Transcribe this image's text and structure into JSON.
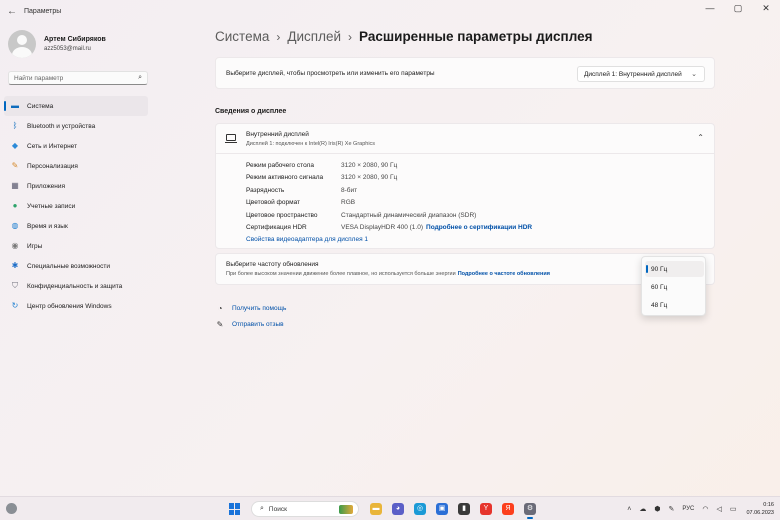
{
  "window": {
    "title": "Параметры",
    "back_glyph": "←",
    "controls": {
      "minimize": "—",
      "maximize": "▢",
      "close": "✕"
    }
  },
  "profile": {
    "name": "Артем Сибиряков",
    "email": "azz5053@mail.ru"
  },
  "search": {
    "placeholder": "Найти параметр",
    "icon": "search-icon"
  },
  "sidebar": {
    "items": [
      {
        "label": "Система",
        "icon": "monitor-icon",
        "active": true,
        "glyph": "▬",
        "color": "#0f6cbd"
      },
      {
        "label": "Bluetooth и устройства",
        "icon": "bluetooth-icon",
        "active": false,
        "glyph": "ᛒ",
        "color": "#0f6cbd"
      },
      {
        "label": "Сеть и Интернет",
        "icon": "network-icon",
        "active": false,
        "glyph": "◆",
        "color": "#2c8ad8"
      },
      {
        "label": "Персонализация",
        "icon": "brush-icon",
        "active": false,
        "glyph": "✎",
        "color": "#d58a2c"
      },
      {
        "label": "Приложения",
        "icon": "apps-icon",
        "active": false,
        "glyph": "▦",
        "color": "#5a5a70"
      },
      {
        "label": "Учетные записи",
        "icon": "account-icon",
        "active": false,
        "glyph": "●",
        "color": "#2ea36b"
      },
      {
        "label": "Время и язык",
        "icon": "globe-icon",
        "active": false,
        "glyph": "◍",
        "color": "#1d7fd1"
      },
      {
        "label": "Игры",
        "icon": "gamepad-icon",
        "active": false,
        "glyph": "◉",
        "color": "#7a7a7a"
      },
      {
        "label": "Специальные возможности",
        "icon": "accessibility-icon",
        "active": false,
        "glyph": "✱",
        "color": "#1e6ec8"
      },
      {
        "label": "Конфиденциальность и защита",
        "icon": "shield-icon",
        "active": false,
        "glyph": "⛉",
        "color": "#6b6b78"
      },
      {
        "label": "Центр обновления Windows",
        "icon": "update-icon",
        "active": false,
        "glyph": "↻",
        "color": "#1d7fd1"
      }
    ]
  },
  "breadcrumb": {
    "item1": "Система",
    "item2": "Дисплей",
    "current": "Расширенные параметры дисплея",
    "sep": "›"
  },
  "display_select": {
    "label": "Выберите дисплей, чтобы просмотреть или изменить его параметры",
    "value": "Дисплей 1: Внутренний дисплей",
    "chevron": "⌄"
  },
  "info": {
    "section_title": "Сведения о дисплее",
    "header_title": "Внутренний дисплей",
    "header_subtitle": "Дисплей 1: подключен к Intel(R) Iris(R) Xe Graphics",
    "collapse_glyph": "⌃",
    "rows": [
      {
        "key": "Режим рабочего стола",
        "value": "3120 × 2080, 90 Гц"
      },
      {
        "key": "Режим активного сигнала",
        "value": "3120 × 2080, 90 Гц"
      },
      {
        "key": "Разрядность",
        "value": "8-бит"
      },
      {
        "key": "Цветовой формат",
        "value": "RGB"
      },
      {
        "key": "Цветовое пространство",
        "value": "Стандартный динамический диапазон (SDR)"
      },
      {
        "key": "Сертификация HDR",
        "value": "VESA DisplayHDR 400 (1.0)",
        "link": "Подробнее о сертификации HDR"
      }
    ],
    "adapter_link": "Свойства видеоадаптера для дисплея 1"
  },
  "refresh": {
    "title": "Выберите частоту обновления",
    "desc": "При более высоком значении движение более плавное, но используется больше энергии",
    "link": "Подробнее о частоте обновления",
    "options": [
      "90 Гц",
      "60 Гц",
      "48 Гц"
    ],
    "selected": "90 Гц"
  },
  "help": {
    "get_help": "Получить помощь",
    "feedback": "Отправить отзыв"
  },
  "taskbar": {
    "search_label": "Поиск",
    "apps": [
      {
        "name": "file-explorer-icon",
        "color": "#e9b53a"
      },
      {
        "name": "chat-icon",
        "color": "#5b5fc7"
      },
      {
        "name": "edge-icon",
        "color": "#1b9ad6"
      },
      {
        "name": "store-icon",
        "color": "#2b6fd6"
      },
      {
        "name": "yandex-music-icon",
        "color": "#3a3a3a"
      },
      {
        "name": "y-browser-icon",
        "color": "#e6342c"
      },
      {
        "name": "yandex-icon",
        "color": "#fc3f1d"
      },
      {
        "name": "settings-icon",
        "color": "#6b6b78"
      }
    ],
    "lang": "РУС",
    "time": "0:16",
    "date": "07.06.2023"
  },
  "colors": {
    "accent": "#0067c0",
    "link": "#0050a8"
  }
}
